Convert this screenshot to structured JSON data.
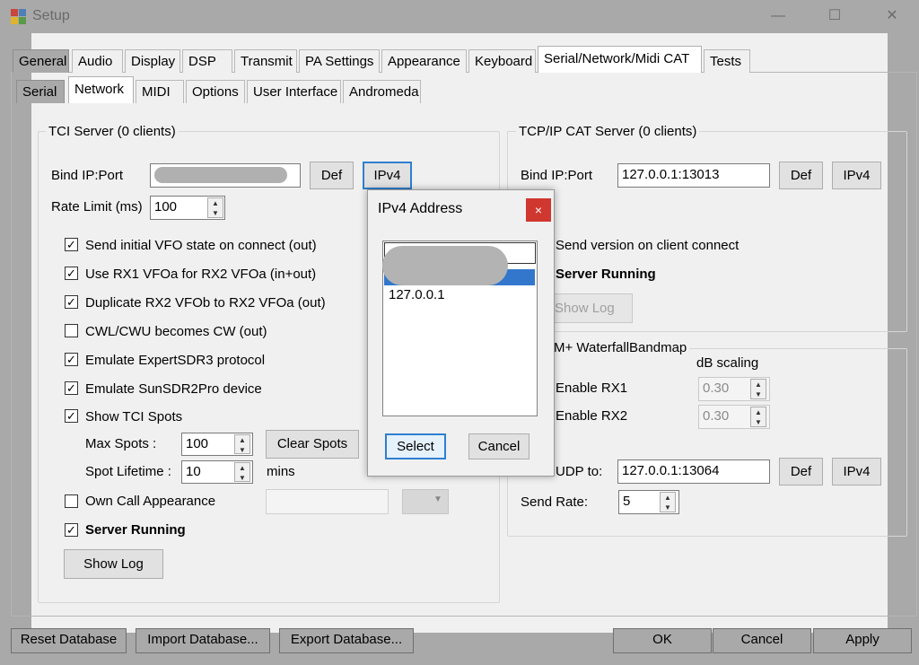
{
  "window": {
    "title": "Setup",
    "minimize": "—",
    "maximize": "☐",
    "close": "✕"
  },
  "tabs_top": [
    "General",
    "Audio",
    "Display",
    "DSP",
    "Transmit",
    "PA Settings",
    "Appearance",
    "Keyboard",
    "Serial/Network/Midi CAT",
    "Tests"
  ],
  "tabs_sub": [
    "Serial",
    "Network",
    "MIDI",
    "Options",
    "User Interface",
    "Andromeda"
  ],
  "tci": {
    "group_title": "TCI Server (0 clients)",
    "bind_label": "Bind IP:Port",
    "def_label": "Def",
    "ipv4_label": "IPv4",
    "rate_label": "Rate Limit (ms)",
    "rate_value": "100",
    "checks": [
      {
        "label": "Send initial VFO state on connect (out)",
        "checked": true
      },
      {
        "label": "Use RX1 VFOa for RX2 VFOa (in+out)",
        "checked": true
      },
      {
        "label": "Duplicate RX2 VFOb to RX2 VFOa (out)",
        "checked": true
      },
      {
        "label": "CWL/CWU becomes CW (out)",
        "checked": false
      },
      {
        "label": "Emulate ExpertSDR3 protocol",
        "checked": true
      },
      {
        "label": "Emulate SunSDR2Pro device",
        "checked": true
      },
      {
        "label": "Show TCI Spots",
        "checked": true
      }
    ],
    "max_spots_label": "Max Spots :",
    "max_spots_value": "100",
    "clear_spots_label": "Clear Spots",
    "spot_lifetime_label": "Spot Lifetime :",
    "spot_lifetime_value": "10",
    "mins_label": "mins",
    "own_call_label": "Own Call Appearance",
    "server_running_label": "Server Running",
    "show_log_label": "Show Log"
  },
  "tcp": {
    "group_title": "TCP/IP CAT Server (0 clients)",
    "bind_label": "Bind IP:Port",
    "bind_value": "127.0.0.1:13013",
    "def_label": "Def",
    "ipv4_label": "IPv4",
    "send_version_label": "Send version on client connect",
    "server_running_label": "Server Running",
    "show_log_label": "Show Log"
  },
  "waterfall": {
    "group_title": "M+ WaterfallBandmap",
    "db_scaling_label": "dB scaling",
    "enable_rx1_label": "Enable RX1",
    "enable_rx1_value": "0.30",
    "enable_rx2_label": "Enable RX2",
    "enable_rx2_value": "0.30",
    "udp_label": "UDP to:",
    "udp_value": "127.0.0.1:13064",
    "def_label": "Def",
    "ipv4_label": "IPv4",
    "send_rate_label": "Send Rate:",
    "send_rate_value": "5"
  },
  "dialog": {
    "title": "IPv4 Address",
    "close": "×",
    "list_items": [
      "127.0.0.1"
    ],
    "select_label": "Select",
    "cancel_label": "Cancel"
  },
  "footer": {
    "reset_label": "Reset Database",
    "import_label": "Import Database...",
    "export_label": "Export Database...",
    "ok_label": "OK",
    "cancel_label": "Cancel",
    "apply_label": "Apply"
  }
}
